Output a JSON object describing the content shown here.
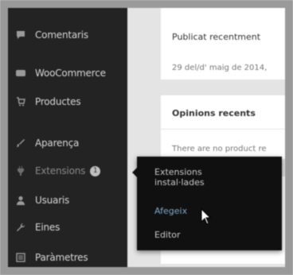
{
  "sidebar": {
    "items": [
      {
        "label": "Comentaris",
        "icon": "comment-icon"
      },
      {
        "label": "WooCommerce",
        "icon": "woocommerce-icon"
      },
      {
        "label": "Productes",
        "icon": "cart-icon"
      },
      {
        "label": "Aparença",
        "icon": "paintbrush-icon"
      },
      {
        "label": "Extensions",
        "icon": "plugin-icon",
        "badge": "1"
      },
      {
        "label": "Usuaris",
        "icon": "users-icon"
      },
      {
        "label": "Eines",
        "icon": "wrench-icon"
      },
      {
        "label": "Paràmetres",
        "icon": "settings-icon"
      }
    ]
  },
  "flyout": {
    "items": [
      {
        "label": "Extensions instal·lades"
      },
      {
        "label": "Afegeix"
      },
      {
        "label": "Editor"
      }
    ]
  },
  "cards": {
    "activity": {
      "title": "Publicat recentment",
      "date": "29 del/d' maig de 2014,"
    },
    "reviews": {
      "title": "Opinions recents",
      "text": "There are no product re"
    }
  },
  "colors": {
    "sidebar": "#232323",
    "flyout": "#101010",
    "link": "#7fa7c6"
  }
}
